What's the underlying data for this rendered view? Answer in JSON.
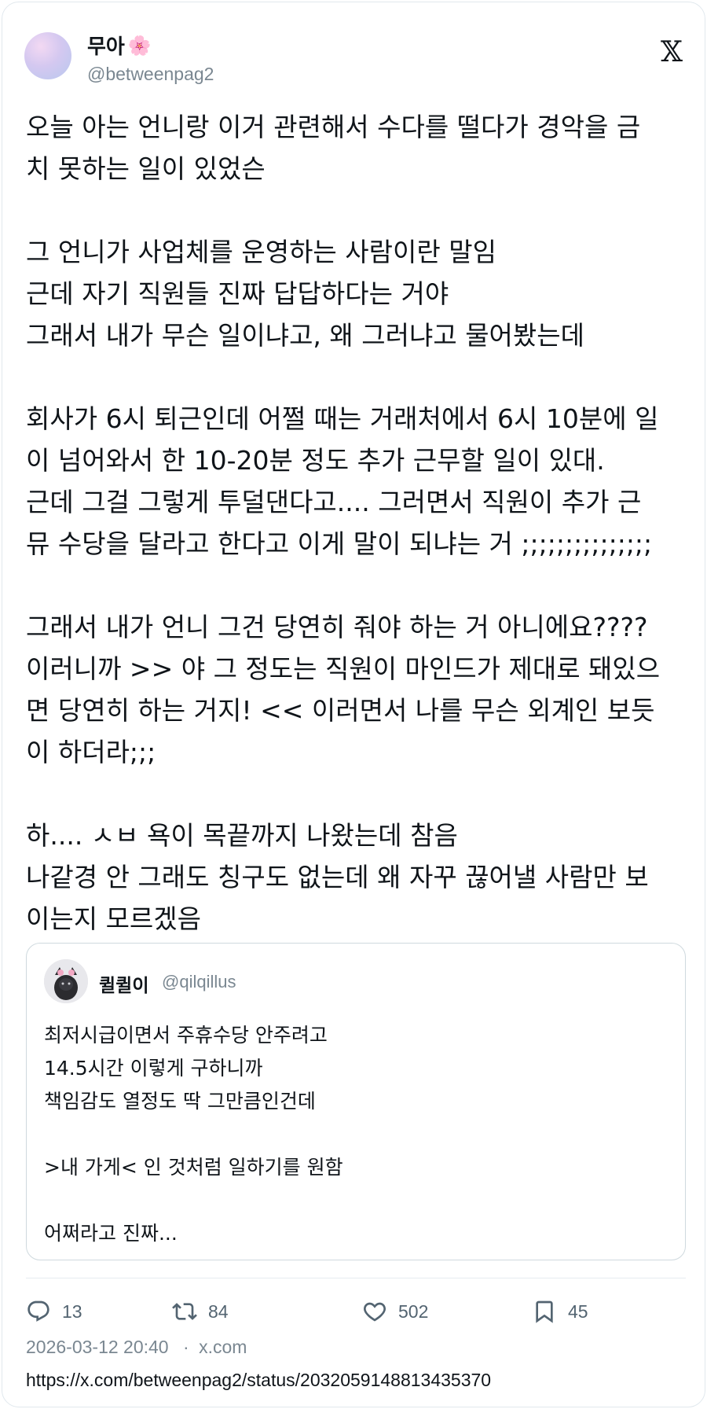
{
  "author": {
    "display_name": "무아",
    "emoji": "🌸",
    "handle": "@betweenpag2"
  },
  "logo": {
    "icon": "x-logo",
    "glyph": "𝕏"
  },
  "body": {
    "paragraphs": [
      "오늘 아는 언니랑 이거 관련해서 수다를 떨다가 경악을 금\n치 못하는 일이 있었슨",
      "그 언니가 사업체를 운영하는 사람이란 말임\n근데 자기 직원들 진짜 답답하다는 거야\n그래서 내가 무슨 일이냐고, 왜 그러냐고 물어봤는데",
      "회사가 6시 퇴근인데 어쩔 때는 거래처에서 6시 10분에 일\n이 넘어와서 한 10-20분 정도 추가 근무할 일이 있대.\n근데 그걸 그렇게 투덜댄다고.... 그러면서 직원이 추가 근\n뮤 수당을 달라고 한다고 이게 말이 되냐는 거 ;;;;;;;;;;;;;;;",
      "그래서 내가 언니 그건 당연히 줘야 하는 거 아니에요????\n이러니까 >> 야 그 정도는 직원이 마인드가 제대로 돼있으\n면 당연히 하는 거지! << 이러면서 나를 무슨 외계인 보듯\n이 하더라;;;",
      "하.... ㅅㅂ 욕이 목끝까지 나왔는데 참음\n나같경 안 그래도 칭구도 없는데 왜 자꾸 끊어낼 사람만 보\n이는지 모르겠음"
    ]
  },
  "quote": {
    "display_name": "퀼퀼이",
    "handle": "@qilqillus",
    "paragraphs": [
      "최저시급이면서 주휴수당 안주려고\n14.5시간 이렇게 구하니까\n책임감도 열정도 딱 그만큼인건데",
      ">내 가게< 인 것처럼 일하기를 원함",
      "어쩌라고 진짜..."
    ]
  },
  "actions": {
    "reply": {
      "icon": "reply-icon",
      "count": "13"
    },
    "retweet": {
      "icon": "retweet-icon",
      "count": "84"
    },
    "like": {
      "icon": "heart-icon",
      "count": "502"
    },
    "bookmark": {
      "icon": "bookmark-icon",
      "count": "45"
    }
  },
  "meta": {
    "timestamp": "2026-03-12 20:40",
    "separator": "·",
    "source": "x.com"
  },
  "url": "https://x.com/betweenpag2/status/2032059148813435370",
  "colors": {
    "text": "#0f1419",
    "secondary": "#536471",
    "border": "#cfd9de"
  }
}
